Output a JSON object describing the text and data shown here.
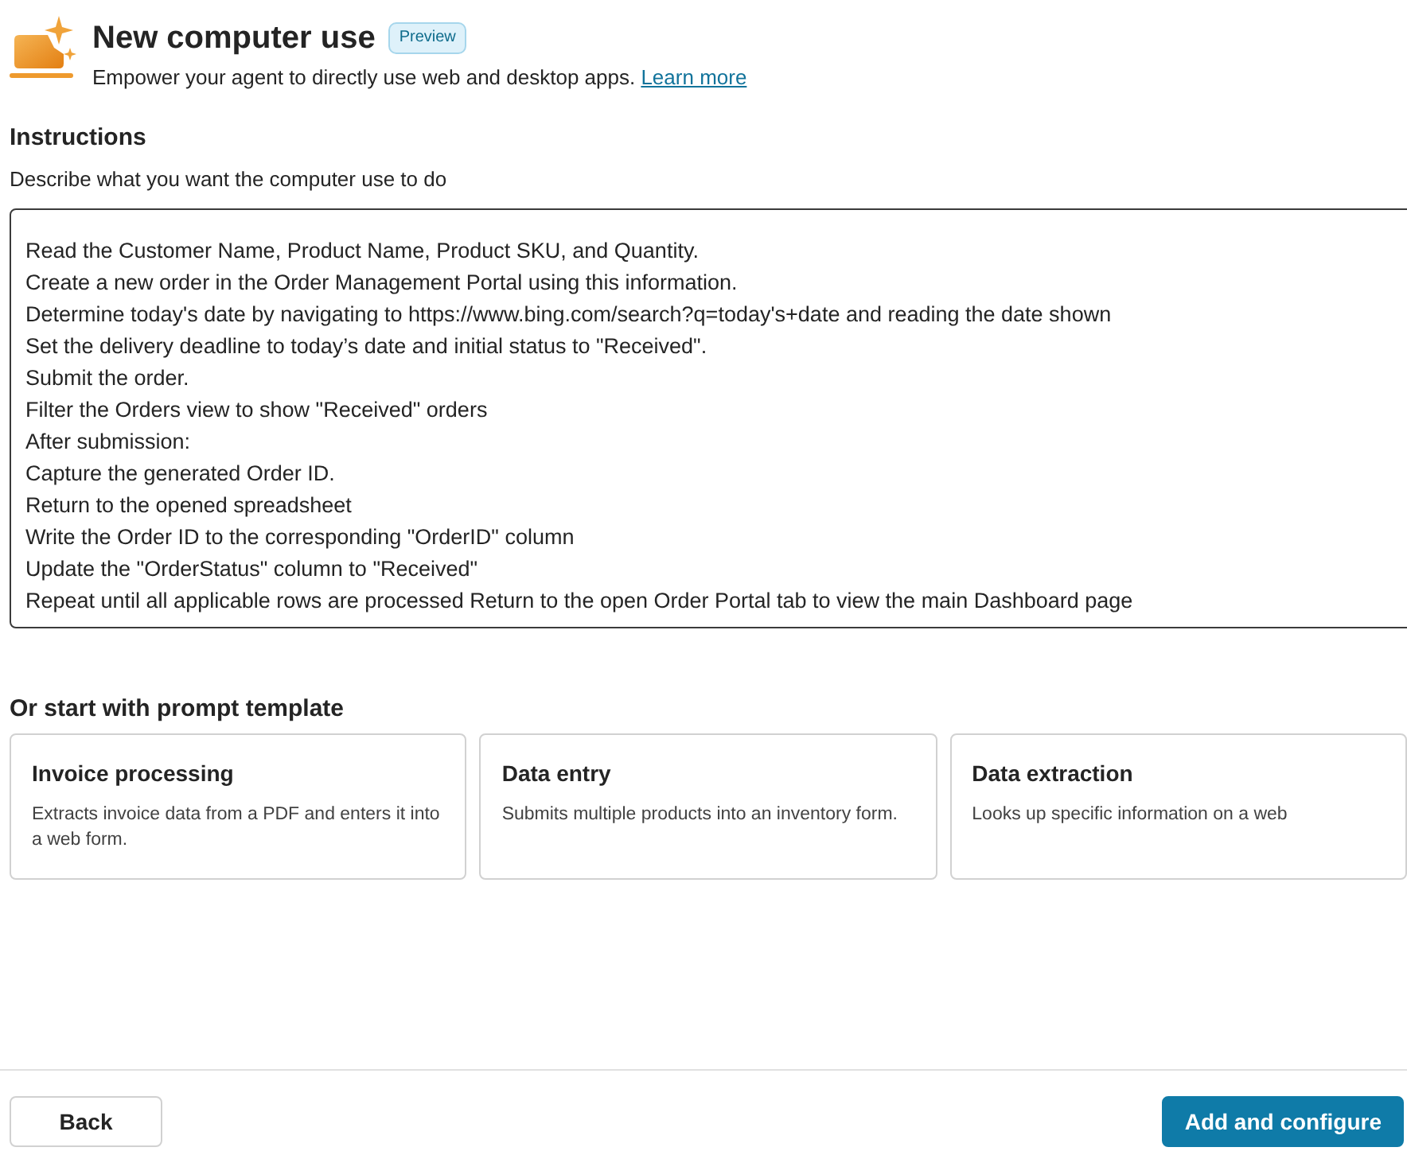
{
  "header": {
    "title": "New computer use",
    "badge": "Preview",
    "subtitle": "Empower your agent to directly use web and desktop apps.",
    "link": "Learn more"
  },
  "instructions": {
    "heading": "Instructions",
    "description": "Describe what you want the computer use to do",
    "value": [
      "Read the Customer Name, Product Name, Product SKU, and Quantity.",
      "Create a new order in the Order Management Portal using this information.",
      "Determine today's date by navigating to https://www.bing.com/search?q=today's+date and reading the date shown",
      "Set the delivery deadline to today’s date and initial status to \"Received\".",
      "Submit the order.",
      "Filter the Orders view to show \"Received\" orders",
      "After submission:",
      "Capture the generated Order ID.",
      "Return to the opened spreadsheet",
      "Write the Order ID to the corresponding \"OrderID\" column",
      "Update the \"OrderStatus\" column to \"Received\"",
      "Repeat until all applicable rows are processed Return to the open Order Portal tab to view the main Dashboard page"
    ]
  },
  "templates": {
    "heading": "Or start with prompt template",
    "cards": [
      {
        "title": "Invoice processing",
        "description": "Extracts invoice data from a PDF and enters it into a web form."
      },
      {
        "title": "Data entry",
        "description": "Submits multiple products into an inventory form."
      },
      {
        "title": "Data extraction",
        "description": "Looks up specific information on a web"
      }
    ]
  },
  "footer": {
    "buttons": [
      {
        "label": "Back",
        "kind": "secondary"
      },
      {
        "label": "Add and configure",
        "kind": "primary"
      }
    ]
  }
}
